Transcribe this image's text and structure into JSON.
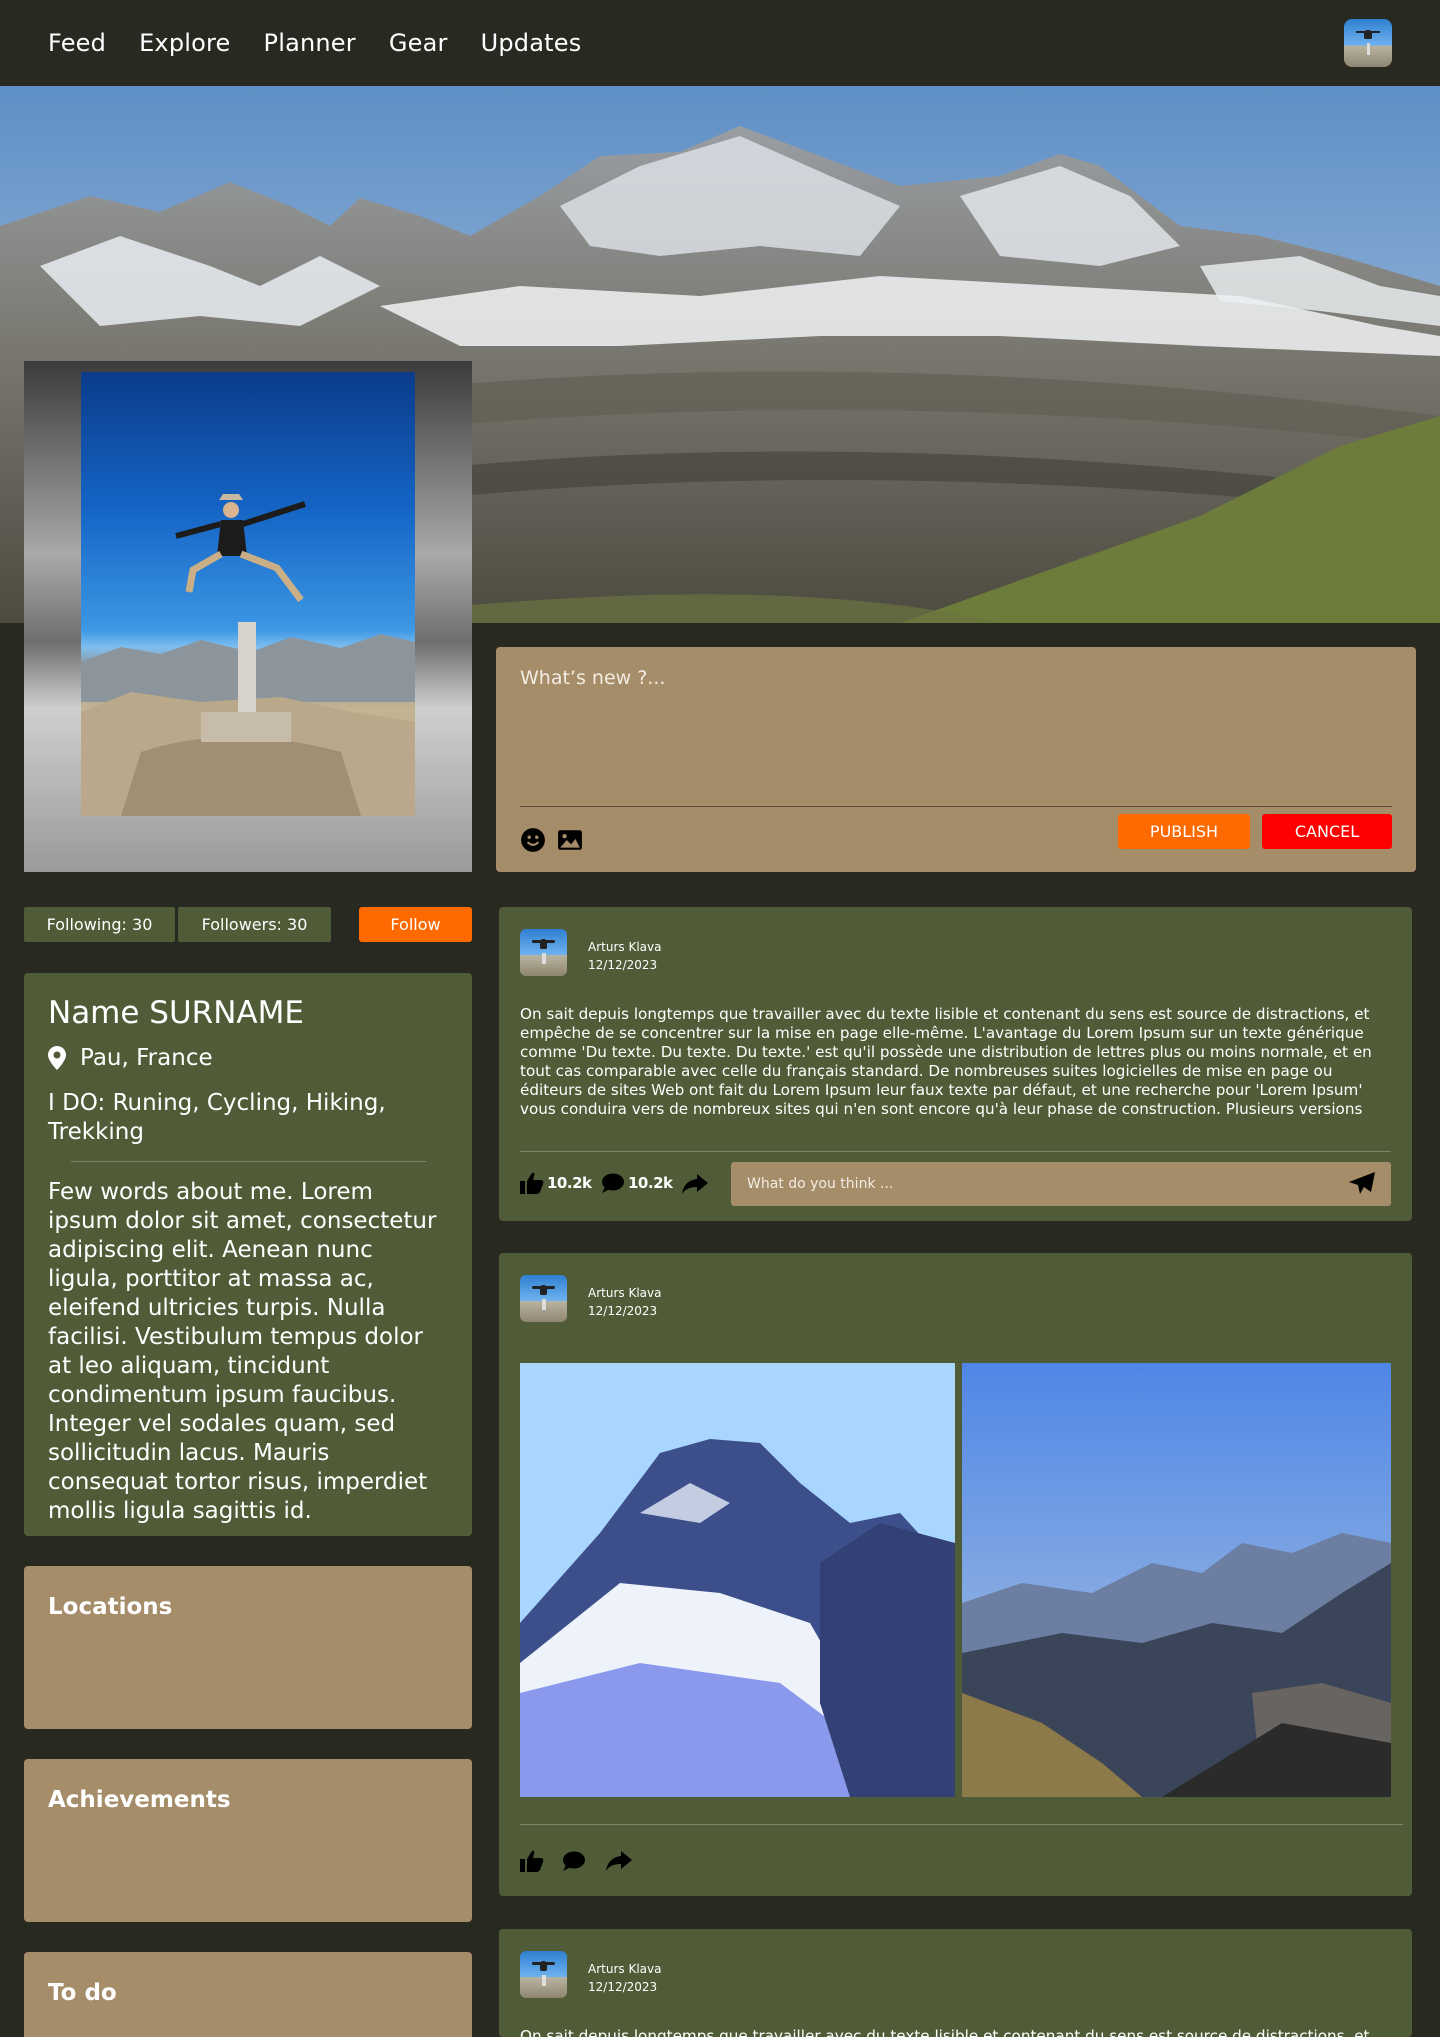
{
  "nav": {
    "items": [
      "Feed",
      "Explore",
      "Planner",
      "Gear",
      "Updates"
    ]
  },
  "composer": {
    "placeholder": "What’s new ?...",
    "publish_label": "PUBLISH",
    "cancel_label": "CANCEL"
  },
  "profile": {
    "following": "Following: 30",
    "followers": "Followers: 30",
    "follow_label": "Follow",
    "name": "Name SURNAME",
    "location": "Pau, France",
    "ido_label": "I DO:",
    "ido_value": " Runing, Cycling, Hiking, Trekking",
    "bio": "Few words about me. Lorem ipsum dolor sit amet, consectetur adipiscing elit. Aenean nunc ligula, porttitor at massa ac, eleifend ultricies turpis. Nulla facilisi. Vestibulum tempus dolor at leo aliquam, tincidunt condimentum ipsum faucibus. Integer vel sodales quam, sed sollicitudin lacus. Mauris consequat tortor risus, imperdiet mollis ligula sagittis id."
  },
  "sections": {
    "locations": "Locations",
    "achievements": "Achievements",
    "todo": "To do"
  },
  "posts": [
    {
      "author": "Arturs Klava",
      "date": "12/12/2023",
      "text": "On sait depuis longtemps que travailler avec du texte lisible et contenant du sens est source de distractions, et empêche de se concentrer sur la mise en page elle-même. L'avantage du Lorem Ipsum sur un texte générique comme 'Du texte. Du texte. Du texte.' est qu'il possède une distribution de lettres plus ou moins normale, et en tout cas comparable avec celle du français standard. De nombreuses suites logicielles de mise en page ou éditeurs de sites Web ont fait du Lorem Ipsum leur faux texte par défaut, et une recherche pour 'Lorem Ipsum' vous conduira vers de nombreux sites qui n'en sont encore qu'à leur phase de construction. Plusieurs versions sont apparues ave",
      "likes": "10.2k",
      "comments": "10.2k",
      "comment_placeholder": "What do you think ..."
    },
    {
      "author": "Arturs Klava",
      "date": "12/12/2023"
    },
    {
      "author": "Arturs Klava",
      "date": "12/12/2023",
      "text": "On sait depuis longtemps que travailler avec du texte lisible et contenant du sens est source de distractions, et"
    }
  ],
  "colors": {
    "background": "#282920",
    "card_green": "#4f5c37",
    "card_tan": "#a58d6a",
    "accent_orange": "#ff6a00",
    "cancel_red": "#ff0000"
  },
  "icons": [
    "emoji-icon",
    "image-icon",
    "location-pin-icon",
    "thumbs-up-icon",
    "comment-icon",
    "share-icon",
    "send-icon"
  ]
}
